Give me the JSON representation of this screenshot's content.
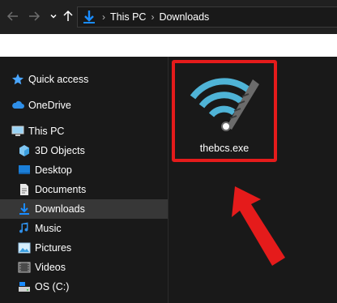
{
  "toolbar": {
    "back_icon": "back-arrow-icon",
    "forward_icon": "forward-arrow-icon",
    "recent_icon": "chevron-down-icon",
    "up_icon": "up-arrow-icon"
  },
  "address_bar": {
    "location_icon": "downloads-icon",
    "breadcrumbs": [
      "This PC",
      "Downloads"
    ]
  },
  "sidebar": {
    "items": [
      {
        "label": "Quick access",
        "icon": "star-icon"
      },
      {
        "label": "OneDrive",
        "icon": "cloud-icon"
      },
      {
        "label": "This PC",
        "icon": "computer-icon"
      },
      {
        "label": "3D Objects",
        "icon": "cube-icon"
      },
      {
        "label": "Desktop",
        "icon": "desktop-icon"
      },
      {
        "label": "Documents",
        "icon": "document-icon"
      },
      {
        "label": "Downloads",
        "icon": "downloads-icon",
        "selected": true
      },
      {
        "label": "Music",
        "icon": "music-icon"
      },
      {
        "label": "Pictures",
        "icon": "pictures-icon"
      },
      {
        "label": "Videos",
        "icon": "videos-icon"
      },
      {
        "label": "OS (C:)",
        "icon": "drive-icon"
      }
    ]
  },
  "files": [
    {
      "name": "thebcs.exe",
      "icon": "wifi-signal-icon"
    }
  ],
  "annotation": {
    "highlight_color": "#e51b1b",
    "arrow_icon": "red-pointer-arrow"
  },
  "colors": {
    "accent": "#1a8cff",
    "background": "#191919",
    "selected": "#373737",
    "wifi": "#4fb3d6"
  }
}
